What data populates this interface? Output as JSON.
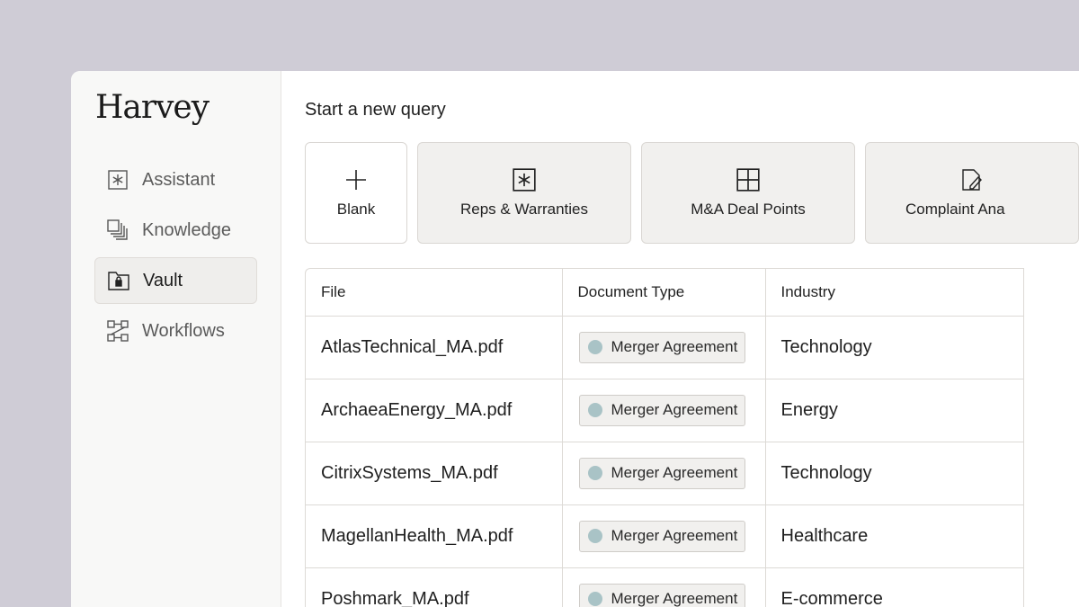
{
  "app": {
    "logo": "Harvey"
  },
  "sidebar": {
    "items": [
      {
        "label": "Assistant",
        "icon": "asterisk-box-icon",
        "active": false
      },
      {
        "label": "Knowledge",
        "icon": "stacked-squares-icon",
        "active": false
      },
      {
        "label": "Vault",
        "icon": "folder-lock-icon",
        "active": true
      },
      {
        "label": "Workflows",
        "icon": "workflow-icon",
        "active": false
      }
    ]
  },
  "main": {
    "heading": "Start a new query",
    "cards": [
      {
        "label": "Blank",
        "icon": "plus-icon"
      },
      {
        "label": "Reps & Warranties",
        "icon": "asterisk-box-icon"
      },
      {
        "label": "M&A Deal Points",
        "icon": "grid-icon"
      },
      {
        "label": "Complaint Ana",
        "icon": "document-edit-icon"
      }
    ],
    "table": {
      "columns": [
        "File",
        "Document Type",
        "Industry"
      ],
      "rows": [
        {
          "file": "AtlasTechnical_MA.pdf",
          "type": "Merger Agreement",
          "industry": "Technology"
        },
        {
          "file": "ArchaeaEnergy_MA.pdf",
          "type": "Merger Agreement",
          "industry": "Energy"
        },
        {
          "file": "CitrixSystems_MA.pdf",
          "type": "Merger Agreement",
          "industry": "Technology"
        },
        {
          "file": "MagellanHealth_MA.pdf",
          "type": "Merger Agreement",
          "industry": "Healthcare"
        },
        {
          "file": "Poshmark_MA.pdf",
          "type": "Merger Agreement",
          "industry": "E-commerce"
        }
      ]
    }
  },
  "colors": {
    "background": "#cfccd6",
    "badge_dot": "#a9c3c6",
    "active_nav": "#efeeec"
  }
}
